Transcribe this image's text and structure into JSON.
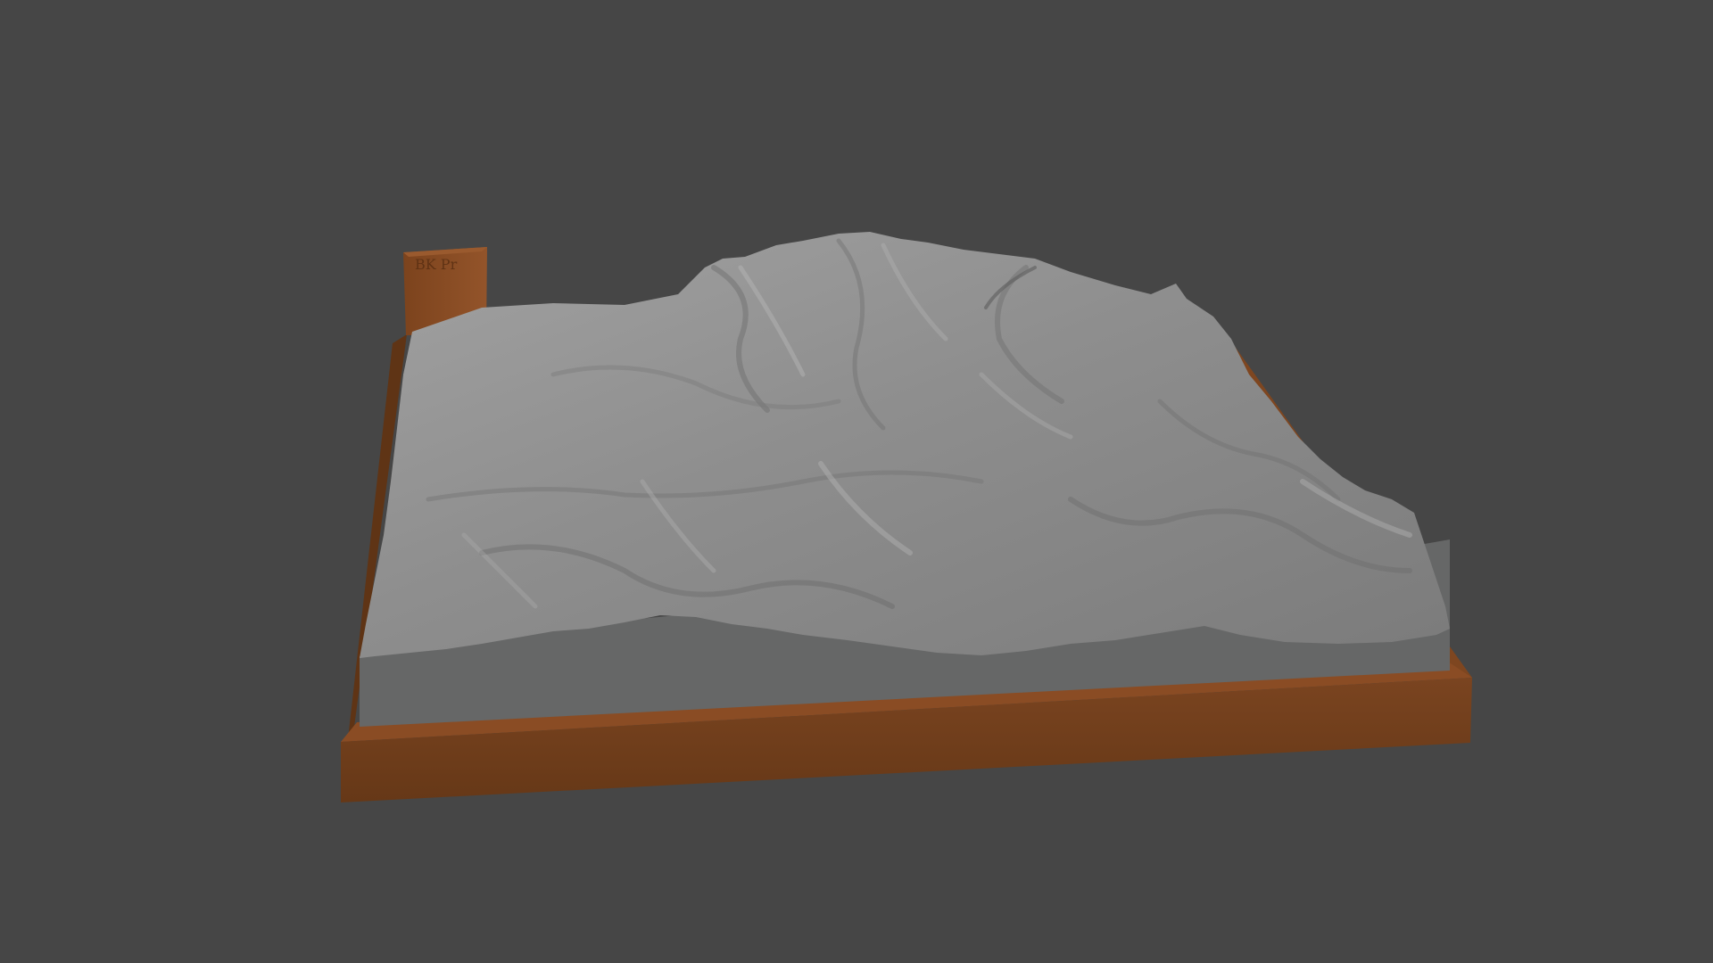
{
  "scene": {
    "background_color": "#464646",
    "terrain_color": "#8d8d8d",
    "terrain_side_color": "#666767",
    "base_color": "#6b3b1b",
    "base_top_color": "#8a4c24",
    "label_block_color": "#85491f",
    "label_block_engraving": "BK Pr"
  }
}
